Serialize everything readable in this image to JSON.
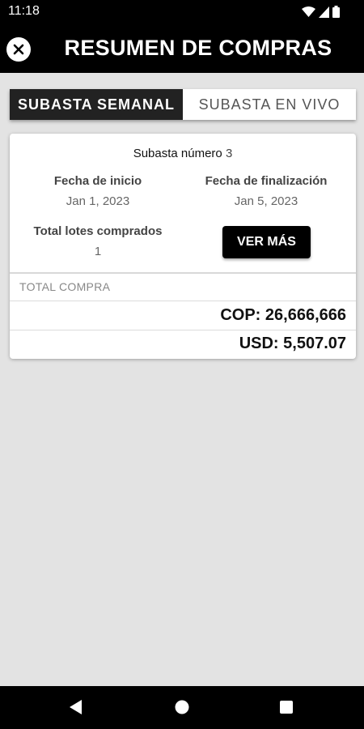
{
  "status_bar": {
    "time": "11:18"
  },
  "header": {
    "title": "RESUMEN DE COMPRAS"
  },
  "tabs": [
    {
      "label": "SUBASTA SEMANAL",
      "active": true
    },
    {
      "label": "SUBASTA EN VIVO",
      "active": false
    }
  ],
  "card": {
    "auction_label": "Subasta número",
    "auction_number": "3",
    "start_label": "Fecha de inicio",
    "start_value": "Jan 1, 2023",
    "end_label": "Fecha de finalización",
    "end_value": "Jan 5, 2023",
    "lots_label": "Total lotes comprados",
    "lots_value": "1",
    "button_label": "VER MÁS",
    "total_label": "TOTAL COMPRA",
    "total_cop": "COP: 26,666,666",
    "total_usd": "USD: 5,507.07"
  },
  "colors": {
    "header_bg": "#000000",
    "background": "#e3e3e3",
    "active_tab": "#222222"
  }
}
